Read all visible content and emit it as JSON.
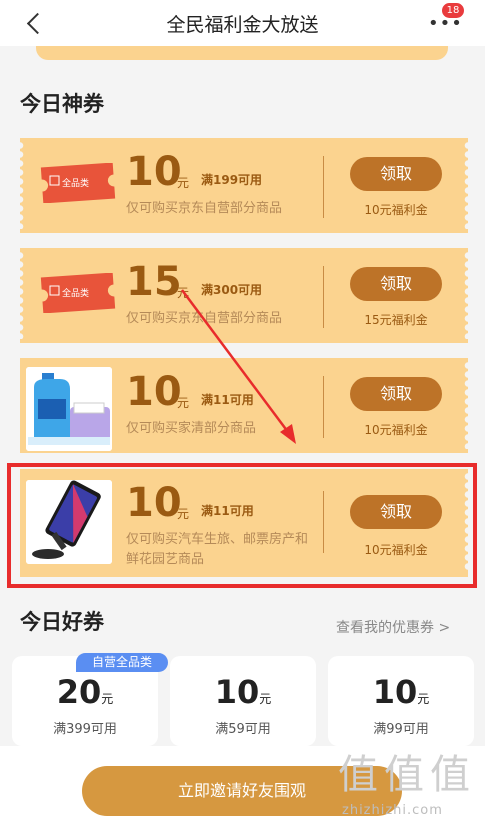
{
  "header": {
    "title": "全民福利金大放送",
    "badge": "18"
  },
  "sections": {
    "today_special": "今日神券",
    "today_good": "今日好券",
    "view_mine": "查看我的优惠券 >"
  },
  "coupons": [
    {
      "ticket_label": "全品类",
      "amount": "10",
      "unit": "元",
      "condition": "满199可用",
      "desc": "仅可购买京东自营部分商品",
      "button": "领取",
      "cost": "10元福利金"
    },
    {
      "ticket_label": "全品类",
      "amount": "15",
      "unit": "元",
      "condition": "满300可用",
      "desc": "仅可购买京东自营部分商品",
      "button": "领取",
      "cost": "15元福利金"
    },
    {
      "amount": "10",
      "unit": "元",
      "condition": "满11可用",
      "desc": "仅可购买家清部分商品",
      "button": "领取",
      "cost": "10元福利金"
    },
    {
      "amount": "10",
      "unit": "元",
      "condition": "满11可用",
      "desc": "仅可购买汽车生旅、邮票房产和鲜花园艺商品",
      "button": "领取",
      "cost": "10元福利金"
    }
  ],
  "good_coupons": [
    {
      "tag": "自营全品类",
      "amount": "20",
      "unit": "元",
      "condition": "满399可用"
    },
    {
      "amount": "10",
      "unit": "元",
      "condition": "满59可用"
    },
    {
      "amount": "10",
      "unit": "元",
      "condition": "满99可用"
    }
  ],
  "bottom": {
    "invite": "立即邀请好友围观"
  },
  "watermark": {
    "logo": "值值值",
    "site": "zhizhizhi.com"
  },
  "colors": {
    "coupon_bg": "#fbd38f",
    "accent": "#bd7328",
    "highlight": "#e82c2c",
    "tag_blue": "#5a8ef2"
  },
  "icons": [
    "back-arrow-icon",
    "more-dots-icon",
    "ticket-icon",
    "detergent-photo",
    "phone-holder-photo"
  ]
}
